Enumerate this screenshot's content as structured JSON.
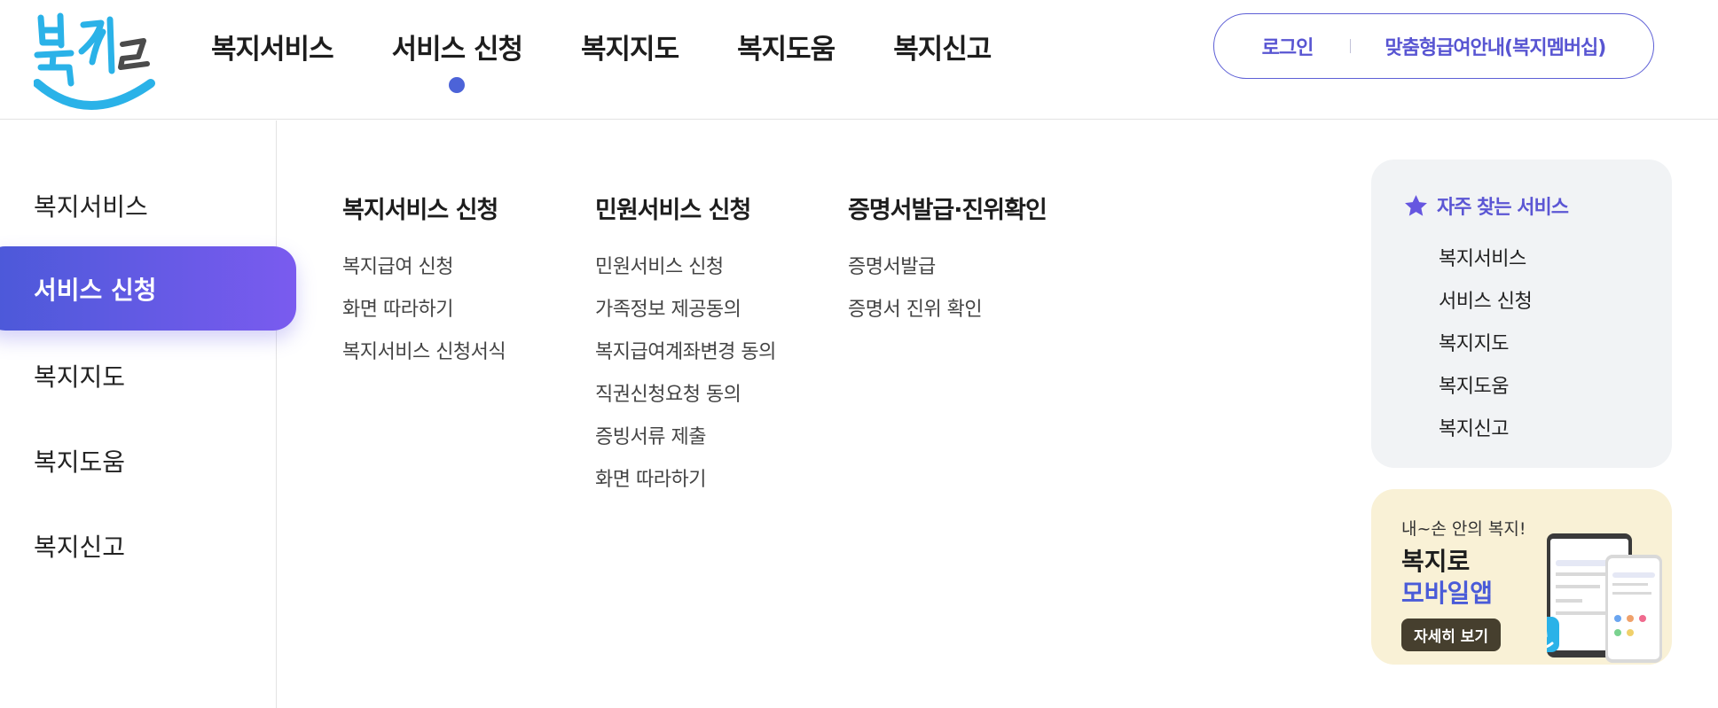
{
  "logo": {
    "text": "복지로"
  },
  "gnb": {
    "items": [
      {
        "label": "복지서비스"
      },
      {
        "label": "서비스 신청",
        "active": true
      },
      {
        "label": "복지지도"
      },
      {
        "label": "복지도움"
      },
      {
        "label": "복지신고"
      }
    ]
  },
  "auth": {
    "login_label": "로그인",
    "membership_label": "맞춤형급여안내(복지멤버십)"
  },
  "side_menu": {
    "items": [
      {
        "label": "복지서비스"
      },
      {
        "label": "서비스 신청",
        "active": true
      },
      {
        "label": "복지지도"
      },
      {
        "label": "복지도움"
      },
      {
        "label": "복지신고"
      }
    ]
  },
  "submenu": {
    "columns": [
      {
        "title": "복지서비스 신청",
        "links": [
          "복지급여 신청",
          "화면 따라하기",
          "복지서비스 신청서식"
        ]
      },
      {
        "title": "민원서비스 신청",
        "links": [
          "민원서비스 신청",
          "가족정보 제공동의",
          "복지급여계좌변경 동의",
          "직권신청요청 동의",
          "증빙서류 제출",
          "화면 따라하기"
        ]
      },
      {
        "title": "증명서발급·진위확인",
        "links": [
          "증명서발급",
          "증명서 진위 확인"
        ]
      }
    ]
  },
  "favorites": {
    "icon": "star-icon",
    "title": "자주 찾는 서비스",
    "links": [
      "복지서비스",
      "서비스 신청",
      "복지지도",
      "복지도움",
      "복지신고"
    ]
  },
  "app_banner": {
    "subtitle": "내~손 안의 복지!",
    "title_line1": "복지로",
    "title_line2": "모바일앱",
    "button_label": "자세히 보기"
  },
  "colors": {
    "accent": "#5b56d4",
    "active_gradient_start": "#4a59d8",
    "active_gradient_end": "#7a5bef",
    "logo_blue": "#2ab2e8",
    "banner_bg": "#f9f1d6",
    "favorites_bg": "#f1f3f5"
  }
}
